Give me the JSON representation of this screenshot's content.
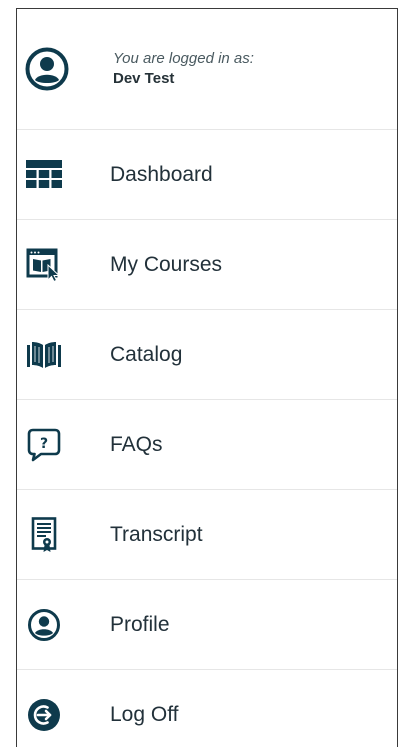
{
  "user": {
    "logged_in_label": "You are logged in as:",
    "name": "Dev Test",
    "icon": "user-circle-icon"
  },
  "menu": {
    "items": [
      {
        "label": "Dashboard",
        "icon": "dashboard-grid-icon"
      },
      {
        "label": "My Courses",
        "icon": "courses-window-icon"
      },
      {
        "label": "Catalog",
        "icon": "open-book-icon"
      },
      {
        "label": "FAQs",
        "icon": "question-bubble-icon"
      },
      {
        "label": "Transcript",
        "icon": "certificate-document-icon"
      },
      {
        "label": "Profile",
        "icon": "user-circle-icon"
      },
      {
        "label": "Log Off",
        "icon": "log-off-icon"
      }
    ]
  },
  "colors": {
    "icon": "#0e3a4c",
    "text": "#22313a",
    "divider": "#e6e6e6",
    "frame": "#3a3a3a"
  }
}
